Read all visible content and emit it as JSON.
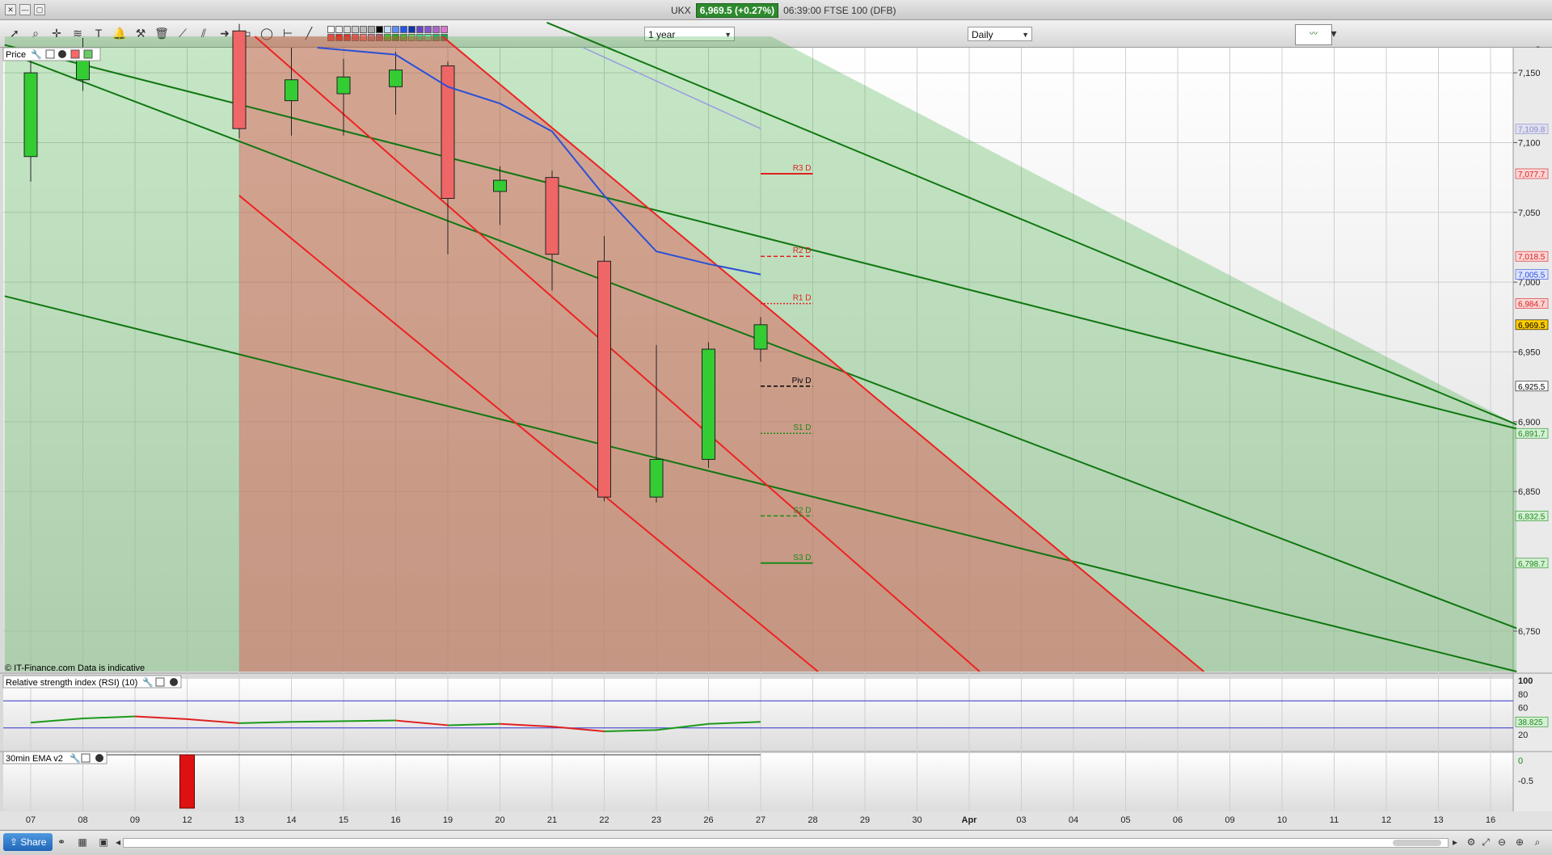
{
  "window": {
    "title_prefix": "UKX",
    "price_badge": "6,969.5 (+0.27%)",
    "title_suffix": "06:39:00 FTSE 100 (DFB)",
    "buttons": [
      "✕",
      "—",
      "▢"
    ]
  },
  "toolbar": {
    "range_label": "1 year",
    "interval_label": "Daily",
    "swatch_colors": [
      "#ffffff",
      "#eeeeee",
      "#dddddd",
      "#cccccc",
      "#bbbbbb",
      "#aaaaaa",
      "#000000",
      "#c8e0ff",
      "#5a8cff",
      "#2255ee",
      "#1133aa",
      "#6644cc",
      "#8855cc",
      "#aa66cc",
      "#dd77cc",
      "#ff4444",
      "#ee2222",
      "#dd3333",
      "#ee5555",
      "#ff7777",
      "#cc7788",
      "#bb5566",
      "#33cc33",
      "#22aa22",
      "#44bb44",
      "#66cc66",
      "#33dd88",
      "#55ee99",
      "#22bb66",
      "#11aa55"
    ]
  },
  "chart_labels": {
    "price_panel": "Price",
    "copyright": "© IT-Finance.com  Data is indicative",
    "rsi_panel": "Relative strength index (RSI) (10)",
    "ema_panel": "30min EMA v2"
  },
  "chart_data": {
    "type": "candlestick",
    "y_ticks": [
      7150,
      7100,
      7050,
      7000,
      6950,
      6900,
      6850,
      6750
    ],
    "y_tick_labels": [
      "7,150",
      "7,100",
      "7,050",
      "7,000",
      "6,950",
      "6,900",
      "6,850",
      "6,750"
    ],
    "ylim": [
      6721,
      7168
    ],
    "x_labels": [
      "07",
      "08",
      "09",
      "12",
      "13",
      "14",
      "15",
      "16",
      "19",
      "20",
      "21",
      "22",
      "23",
      "26",
      "27",
      "28",
      "29",
      "30",
      "Apr",
      "03",
      "04",
      "05",
      "06",
      "09",
      "10",
      "11",
      "12",
      "13",
      "16"
    ],
    "candles": [
      {
        "x": 0,
        "open": 7090,
        "high": 7160,
        "low": 7072,
        "close": 7150
      },
      {
        "x": 1,
        "open": 7145,
        "high": 7175,
        "low": 7137,
        "close": 7168
      },
      {
        "x": 4,
        "open": 7180,
        "high": 7185,
        "low": 7103,
        "close": 7110
      },
      {
        "x": 5,
        "open": 7130,
        "high": 7168,
        "low": 7105,
        "close": 7145
      },
      {
        "x": 6,
        "open": 7135,
        "high": 7160,
        "low": 7105,
        "close": 7147
      },
      {
        "x": 7,
        "open": 7140,
        "high": 7165,
        "low": 7120,
        "close": 7152
      },
      {
        "x": 8,
        "open": 7155,
        "high": 7158,
        "low": 7020,
        "close": 7060
      },
      {
        "x": 9,
        "open": 7065,
        "high": 7083,
        "low": 7041,
        "close": 7073
      },
      {
        "x": 10,
        "open": 7075,
        "high": 7080,
        "low": 6994,
        "close": 7020
      },
      {
        "x": 11,
        "open": 7015,
        "high": 7033,
        "low": 6843,
        "close": 6846
      },
      {
        "x": 12,
        "open": 6846,
        "high": 6955,
        "low": 6842,
        "close": 6873
      },
      {
        "x": 13,
        "open": 6873,
        "high": 6957,
        "low": 6867,
        "close": 6952
      },
      {
        "x": 14,
        "open": 6952,
        "high": 6975,
        "low": 6943,
        "close": 6969.5
      }
    ],
    "ma_line": {
      "color": "#2b4fd6",
      "points": [
        [
          5.5,
          7168
        ],
        [
          7,
          7163
        ],
        [
          8,
          7140
        ],
        [
          9,
          7128
        ],
        [
          10,
          7108
        ],
        [
          11,
          7062
        ],
        [
          12,
          7022
        ],
        [
          13,
          7013
        ],
        [
          14,
          7005.5
        ]
      ]
    },
    "pivots": [
      {
        "name": "R3 D",
        "value": 7077.7,
        "color": "#e02020",
        "style": "solid"
      },
      {
        "name": "R2 D",
        "value": 7018.5,
        "color": "#e02020",
        "style": "dashed"
      },
      {
        "name": "R1 D",
        "value": 6984.7,
        "color": "#e02020",
        "style": "dotted"
      },
      {
        "name": "Piv D",
        "value": 6925.5,
        "color": "#000000",
        "style": "dashed"
      },
      {
        "name": "S1 D",
        "value": 6891.7,
        "color": "#1a8a1a",
        "style": "dotted"
      },
      {
        "name": "S2 D",
        "value": 6832.5,
        "color": "#1a8a1a",
        "style": "dashed"
      },
      {
        "name": "S3 D",
        "value": 6798.7,
        "color": "#1a8a1a",
        "style": "solid"
      }
    ],
    "right_badges": [
      {
        "label": "7,109.8",
        "value": 7109.8,
        "bg": "#e0e0ee",
        "fg": "#8a8acc"
      },
      {
        "label": "7,077.7",
        "value": 7077.7,
        "bg": "#ffd4d4",
        "fg": "#d02020"
      },
      {
        "label": "7,018.5",
        "value": 7018.5,
        "bg": "#ffd4d4",
        "fg": "#d02020"
      },
      {
        "label": "7,005.5",
        "value": 7005.5,
        "bg": "#dde4ff",
        "fg": "#2b4fd6"
      },
      {
        "label": "6,984.7",
        "value": 6984.7,
        "bg": "#ffd4d4",
        "fg": "#d02020"
      },
      {
        "label": "6,969.5",
        "value": 6969.5,
        "bg": "#ffcc00",
        "fg": "#000000"
      },
      {
        "label": "6,925.5",
        "value": 6925.5,
        "bg": "#ffffff",
        "fg": "#000000"
      },
      {
        "label": "6,891.7",
        "value": 6891.7,
        "bg": "#d4f0d4",
        "fg": "#1a8a1a"
      },
      {
        "label": "6,832.5",
        "value": 6832.5,
        "bg": "#d4f0d4",
        "fg": "#1a8a1a"
      },
      {
        "label": "6,798.7",
        "value": 6798.7,
        "bg": "#d4f0d4",
        "fg": "#1a8a1a"
      }
    ],
    "rsi": {
      "ticks": [
        100,
        80,
        60,
        40,
        20
      ],
      "levels": [
        70,
        30
      ],
      "current_label": "38.825",
      "values": [
        [
          0,
          38
        ],
        [
          1,
          44
        ],
        [
          2,
          47
        ],
        [
          3,
          43
        ],
        [
          4,
          37
        ],
        [
          5,
          39
        ],
        [
          6,
          40
        ],
        [
          7,
          41
        ],
        [
          8,
          34
        ],
        [
          9,
          36
        ],
        [
          10,
          32
        ],
        [
          11,
          25
        ],
        [
          12,
          27
        ],
        [
          13,
          36
        ],
        [
          14,
          39
        ]
      ]
    },
    "ema": {
      "ticks": [
        "0",
        "-0.5"
      ],
      "bar_x": 3
    },
    "colors": {
      "up": "#33cc33",
      "down": "#ee6666",
      "channel_green": "#117711",
      "channel_red": "#ee2222"
    }
  }
}
